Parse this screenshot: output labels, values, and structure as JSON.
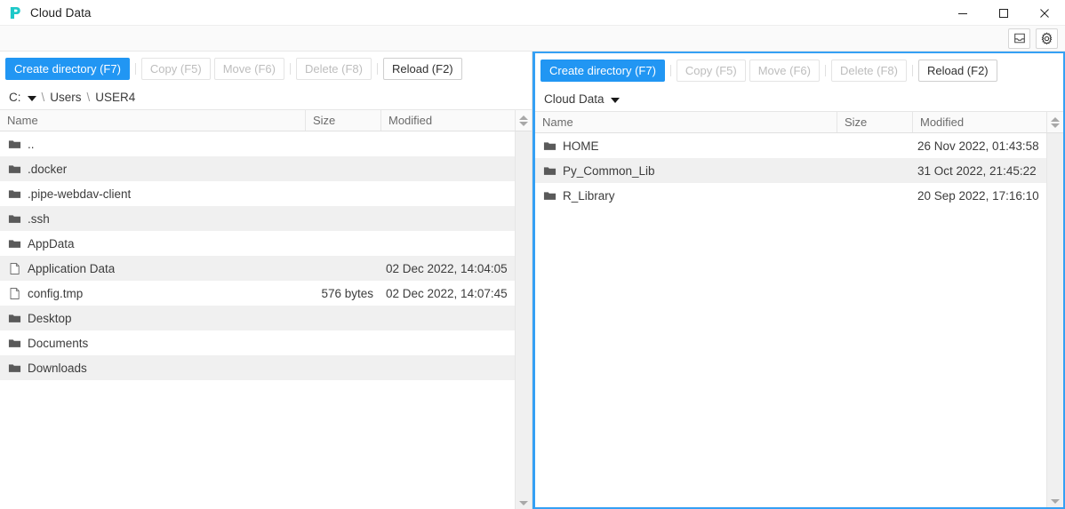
{
  "window": {
    "title": "Cloud Data",
    "logo_icon": "pipe-logo-icon",
    "controls": [
      {
        "name": "minimize-button",
        "icon": "minimize-icon",
        "label": "Minimize"
      },
      {
        "name": "maximize-button",
        "icon": "maximize-icon",
        "label": "Maximize"
      },
      {
        "name": "close-button",
        "icon": "close-icon",
        "label": "Close"
      }
    ]
  },
  "toolbar": {
    "buttons": [
      {
        "name": "inbox-button",
        "icon": "inbox-icon",
        "label": "Inbox"
      },
      {
        "name": "settings-button",
        "icon": "gear-icon",
        "label": "Settings"
      }
    ]
  },
  "colors": {
    "accent": "#2196f3",
    "focus_border": "#35a0f4",
    "logo": "#1ec8c8",
    "row_alt": "#f0f0f0",
    "disabled_text": "#bdbdbd"
  },
  "actions": {
    "create_directory": "Create directory (F7)",
    "copy": "Copy (F5)",
    "move": "Move (F6)",
    "delete": "Delete (F8)",
    "reload": "Reload (F2)"
  },
  "columns": {
    "name": "Name",
    "size": "Size",
    "modified": "Modified"
  },
  "left_panel": {
    "focused": false,
    "path": {
      "drive": "C:",
      "segments": [
        "Users",
        "USER4"
      ],
      "separator": "\\"
    },
    "rows": [
      {
        "icon": "folder-icon",
        "name": "..",
        "size": "",
        "modified": ""
      },
      {
        "icon": "folder-icon",
        "name": ".docker",
        "size": "",
        "modified": ""
      },
      {
        "icon": "folder-icon",
        "name": ".pipe-webdav-client",
        "size": "",
        "modified": ""
      },
      {
        "icon": "folder-icon",
        "name": ".ssh",
        "size": "",
        "modified": ""
      },
      {
        "icon": "folder-icon",
        "name": "AppData",
        "size": "",
        "modified": ""
      },
      {
        "icon": "file-icon",
        "name": "Application Data",
        "size": "",
        "modified": "02 Dec 2022, 14:04:05"
      },
      {
        "icon": "file-icon",
        "name": "config.tmp",
        "size": "576 bytes",
        "modified": "02 Dec 2022, 14:07:45"
      },
      {
        "icon": "folder-icon",
        "name": "Desktop",
        "size": "",
        "modified": ""
      },
      {
        "icon": "folder-icon",
        "name": "Documents",
        "size": "",
        "modified": ""
      },
      {
        "icon": "folder-icon",
        "name": "Downloads",
        "size": "",
        "modified": ""
      }
    ]
  },
  "right_panel": {
    "focused": true,
    "path": {
      "label": "Cloud Data"
    },
    "rows": [
      {
        "icon": "folder-icon",
        "name": "HOME",
        "size": "",
        "modified": "26 Nov 2022, 01:43:58"
      },
      {
        "icon": "folder-icon",
        "name": "Py_Common_Lib",
        "size": "",
        "modified": "31 Oct 2022, 21:45:22"
      },
      {
        "icon": "folder-icon",
        "name": "R_Library",
        "size": "",
        "modified": "20 Sep 2022, 17:16:10"
      }
    ]
  }
}
